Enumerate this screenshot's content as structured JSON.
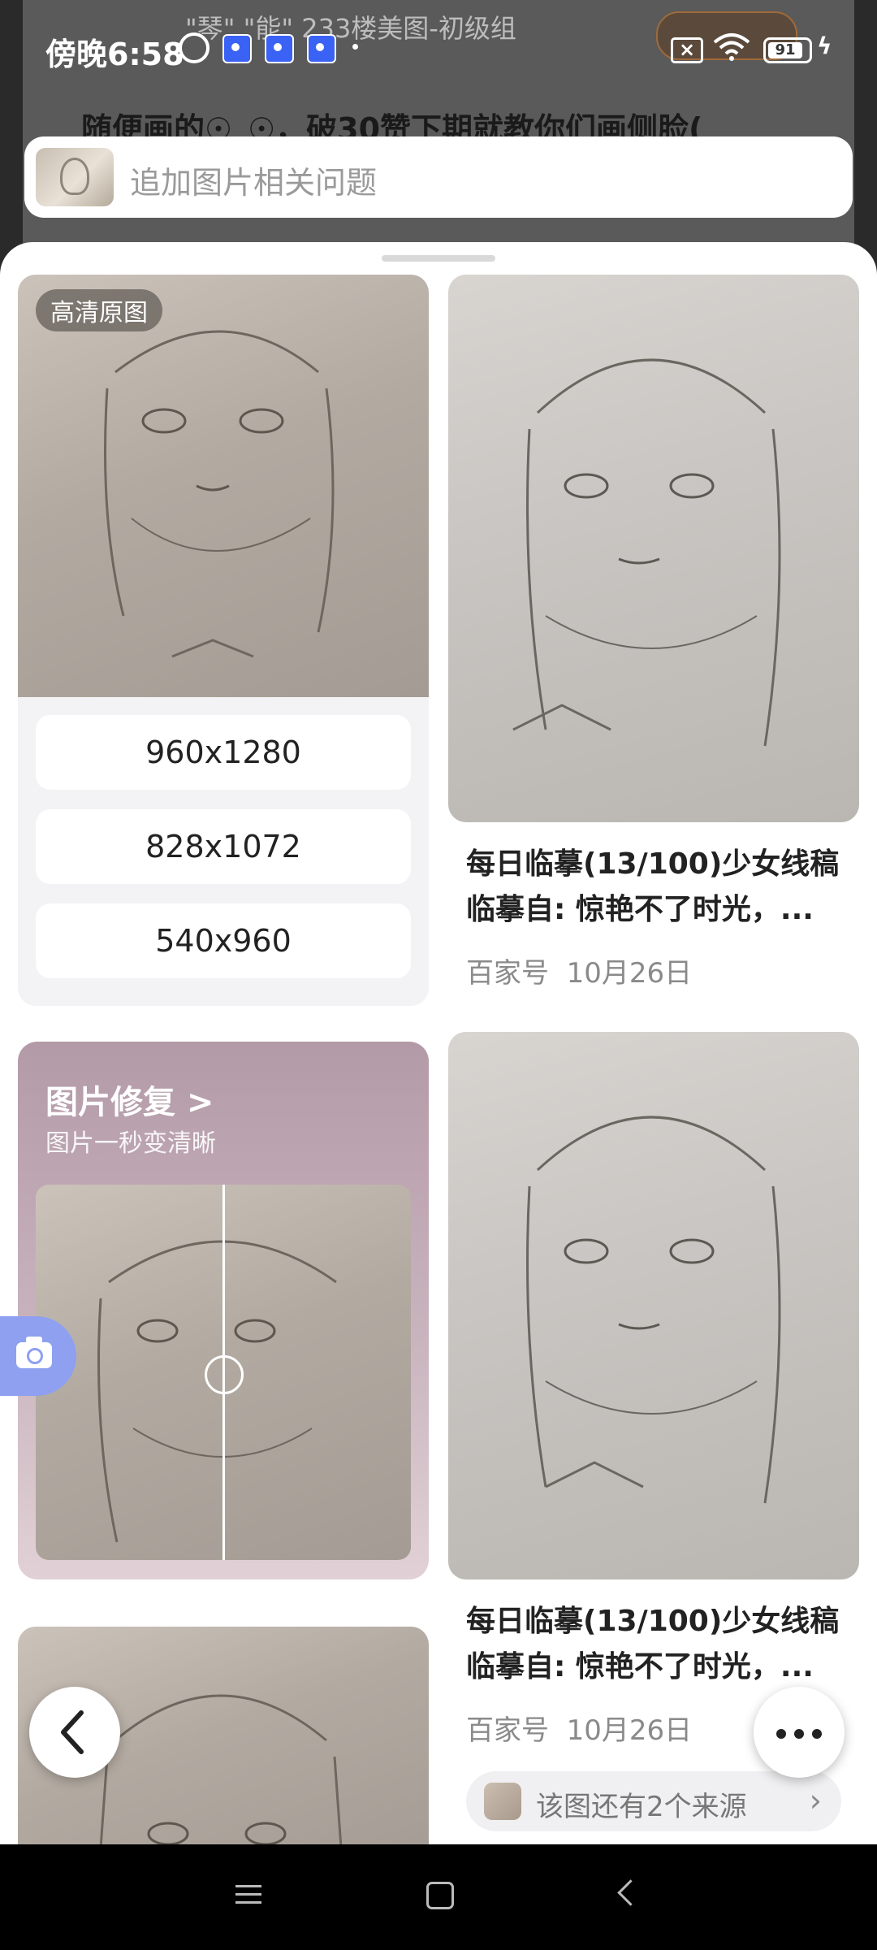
{
  "status_bar": {
    "time": "傍晚6:58",
    "battery": "91"
  },
  "background_page": {
    "header_text": "\"琴\" \"能\"  233楼美图-初级组",
    "post_title": "随便画的☉_☉，破30赞下期就教你们画侧脸("
  },
  "search": {
    "placeholder": "追加图片相关问题"
  },
  "results": {
    "hd_badge": "高清原图",
    "resolutions": [
      "960x1280",
      "828x1072",
      "540x960"
    ],
    "items": [
      {
        "title": "每日临摹(13/100)少女线稿临摹自: 惊艳不了时光，...",
        "source": "百家号",
        "date": "10月26日"
      },
      {
        "title": "每日临摹(13/100)少女线稿临摹自: 惊艳不了时光，...",
        "source": "百家号",
        "date": "10月26日",
        "more_sources": "该图还有2个来源"
      }
    ]
  },
  "promo": {
    "title": "图片修复 >",
    "subtitle": "图片一秒变清晰"
  },
  "colors": {
    "camera_tab": "#8ea0ef",
    "promo_top": "#b39aa7"
  }
}
